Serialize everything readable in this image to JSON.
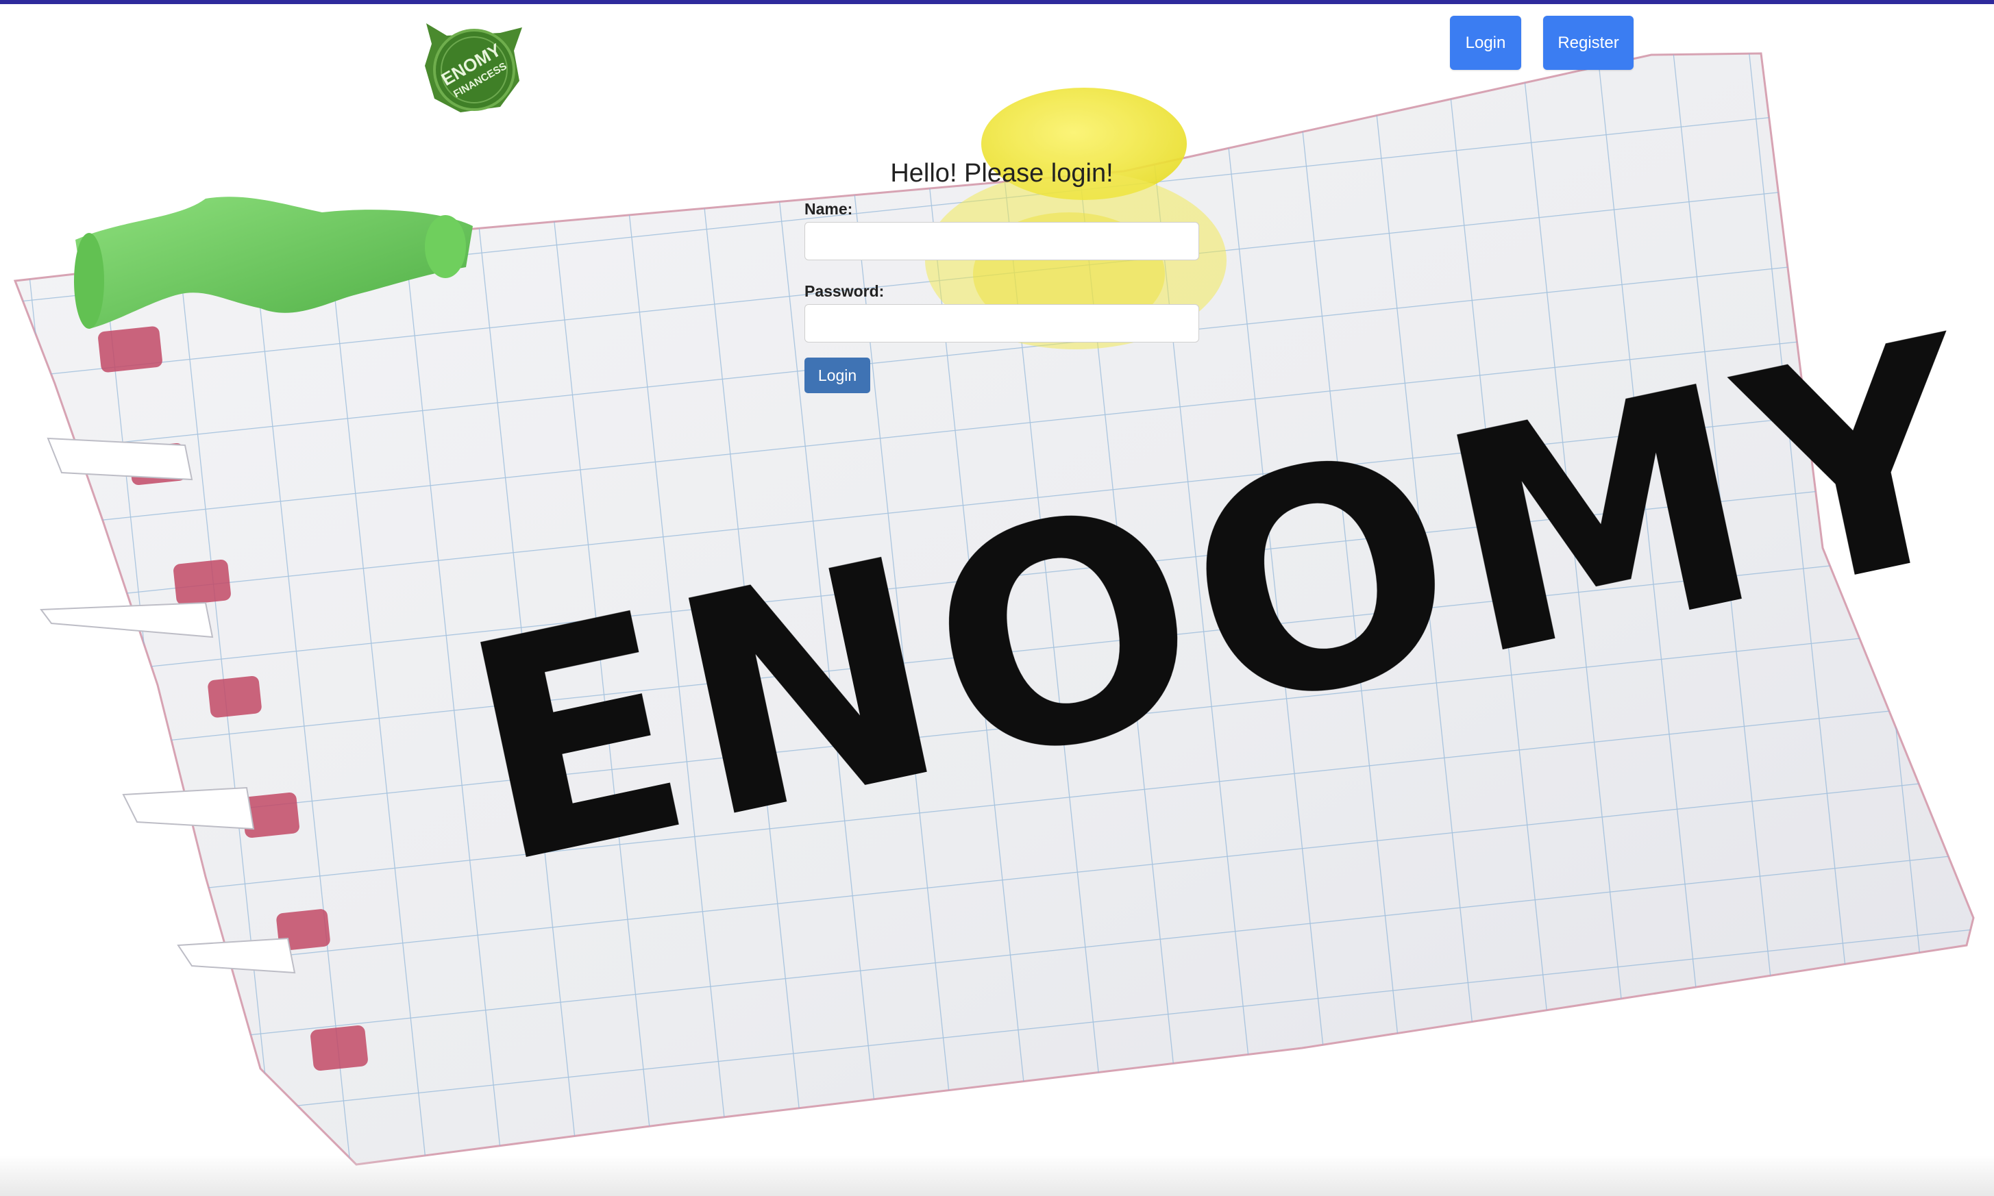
{
  "header": {
    "logo": {
      "icon": "enomy-financess-logo-icon",
      "text_line1": "ENOMY",
      "text_line2": "FINANCESS"
    },
    "nav": {
      "login_label": "Login",
      "register_label": "Register"
    }
  },
  "login": {
    "title": "Hello! Please login!",
    "name_label": "Name:",
    "name_value": "",
    "password_label": "Password:",
    "password_value": "",
    "submit_label": "Login"
  },
  "background": {
    "word": "ENOOMY",
    "icon": "notebook-paper-illustration"
  },
  "colors": {
    "accent_bar": "#2e2a9c",
    "nav_button": "#3b7df2",
    "submit_button": "#3f73b4",
    "logo_green": "#4a8a2e"
  }
}
